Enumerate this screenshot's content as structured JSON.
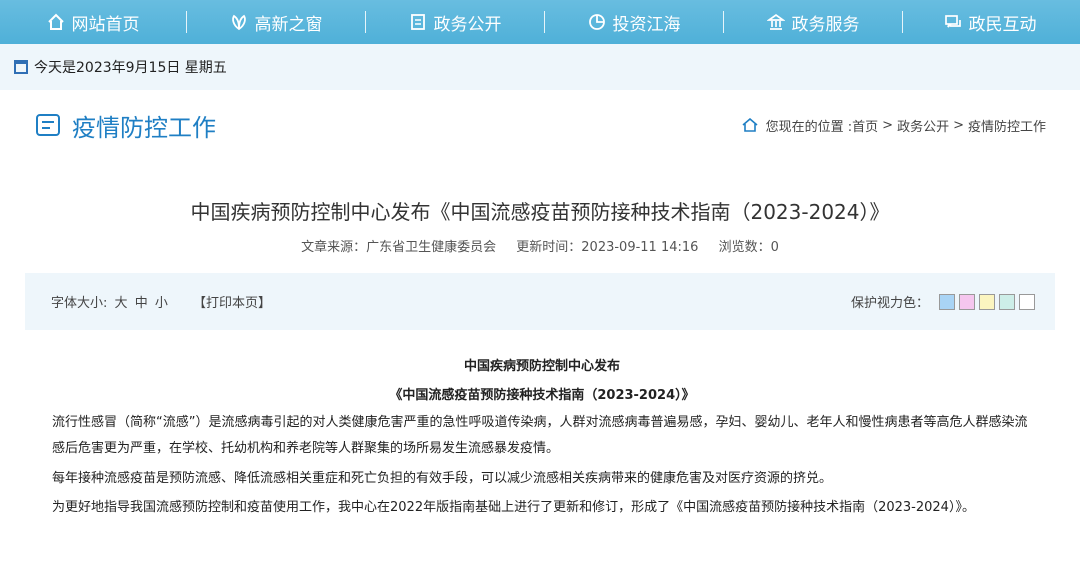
{
  "nav": {
    "items": [
      {
        "label": "网站首页",
        "icon": "home-icon"
      },
      {
        "label": "高新之窗",
        "icon": "leaf-icon"
      },
      {
        "label": "政务公开",
        "icon": "document-icon"
      },
      {
        "label": "投资江海",
        "icon": "pie-chart-icon"
      },
      {
        "label": "政务服务",
        "icon": "building-icon"
      },
      {
        "label": "政民互动",
        "icon": "chat-icon"
      }
    ]
  },
  "date_bar": {
    "text": "今天是2023年9月15日 星期五"
  },
  "section": {
    "title": "疫情防控工作"
  },
  "breadcrumb": {
    "prefix": "您现在的位置 :",
    "items": [
      "首页",
      "政务公开",
      "疫情防控工作"
    ],
    "separator": ">"
  },
  "article": {
    "title": "中国疾病预防控制中心发布《中国流感疫苗预防接种技术指南（2023-2024）》",
    "source": "文章来源：广东省卫生健康委员会",
    "updated": "更新时间：2023-09-11 14:16",
    "views": "浏览数：0"
  },
  "toolbar": {
    "font_size_label": "字体大小:",
    "font_large": "大",
    "font_medium": "中",
    "font_small": "小",
    "print": "【打印本页】",
    "eye_care_label": "保护视力色：",
    "eye_colors": [
      "#a9d4f5",
      "#f5c6ee",
      "#fbf5c0",
      "#cdeee8",
      "#ffffff"
    ]
  },
  "content": {
    "heading1": "中国疾病预防控制中心发布",
    "heading2": "《中国流感疫苗预防接种技术指南（2023-2024）》",
    "para1": "流行性感冒（简称“流感”）是流感病毒引起的对人类健康危害严重的急性呼吸道传染病，人群对流感病毒普遍易感，孕妇、婴幼儿、老年人和慢性病患者等高危人群感染流感后危害更为严重，在学校、托幼机构和养老院等人群聚集的场所易发生流感暴发疫情。",
    "para2": "每年接种流感疫苗是预防流感、降低流感相关重症和死亡负担的有效手段，可以减少流感相关疾病带来的健康危害及对医疗资源的挤兑。",
    "para3": "为更好地指导我国流感预防控制和疫苗使用工作，我中心在2022年版指南基础上进行了更新和修订，形成了《中国流感疫苗预防接种技术指南（2023-2024）》。"
  }
}
